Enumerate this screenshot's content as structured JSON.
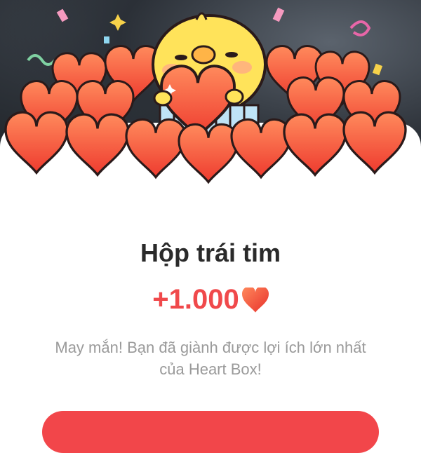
{
  "heart_box": {
    "title": "Hộp trái tim",
    "reward_amount": "+1.000",
    "reward_icon": "heart-icon",
    "description": "May mắn! Bạn đã giành được lợi ích lớn nhất của Heart Box!"
  },
  "colors": {
    "accent": "#f2464a",
    "heart": "#f05a3c",
    "title_text": "#2a2a2a",
    "muted_text": "#9a9a9a"
  }
}
